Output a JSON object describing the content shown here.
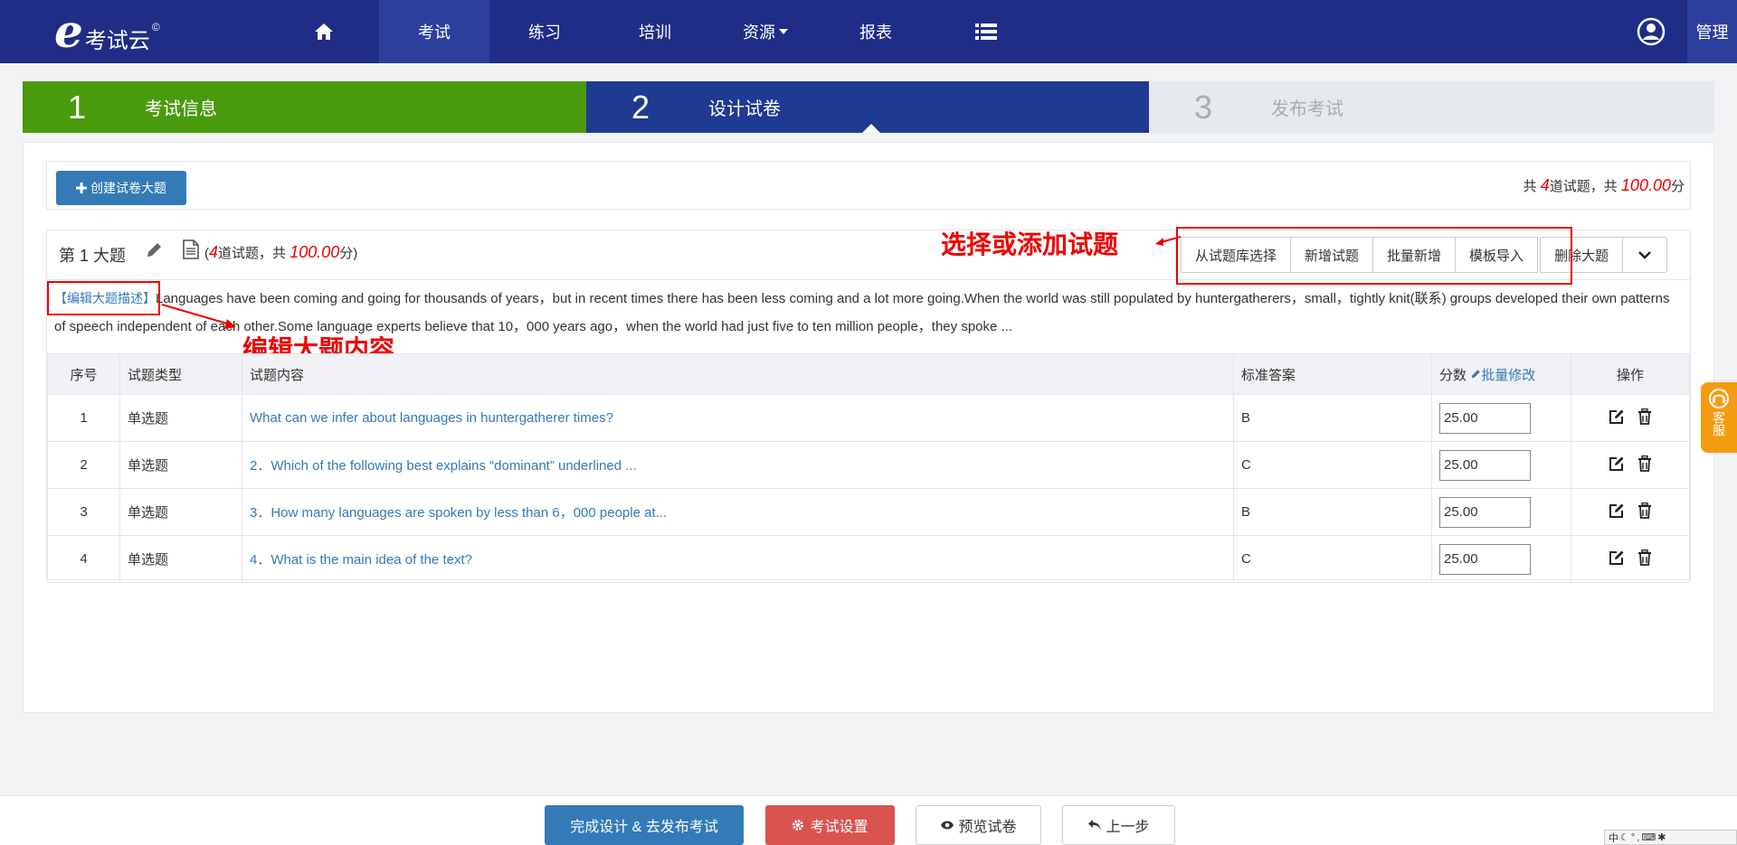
{
  "brand": {
    "name": "考试云",
    "mark": "e",
    "copyright": "©"
  },
  "nav": {
    "items": [
      "考试",
      "练习",
      "培训",
      "资源",
      "报表"
    ],
    "manage": "管理",
    "icons": {
      "home": "home-icon",
      "list": "list-icon",
      "user": "user-icon"
    }
  },
  "steps": [
    {
      "num": "1",
      "label": "考试信息"
    },
    {
      "num": "2",
      "label": "设计试卷"
    },
    {
      "num": "3",
      "label": "发布考试"
    }
  ],
  "toolbar": {
    "create_label": "创建试卷大题",
    "total_prefix": "共",
    "total_count": "4",
    "total_mid": "道试题，共",
    "total_score": "100.00",
    "total_suffix": "分"
  },
  "section": {
    "title": "第 1 大题",
    "count_open": "(",
    "count": "4",
    "count_mid": "道试题，共",
    "score": "100.00",
    "count_close": "分)",
    "buttons": [
      "从试题库选择",
      "新增试题",
      "批量新增",
      "模板导入",
      "删除大题"
    ],
    "annotation_buttons": "选择或添加试题",
    "annotation_desc": "编辑大题内容",
    "desc_link": "【编辑大题描述】",
    "desc_text": "Languages have been coming and going for thousands of years，but in recent times there has been less coming and a lot more going.When the world was still populated by huntergatherers，small，tightly knit(联系) groups developed their own patterns of speech independent of each other.Some language experts believe that 10，000 years ago，when the world had just five to ten million people，they spoke ..."
  },
  "table": {
    "headers": {
      "no": "序号",
      "type": "试题类型",
      "content": "试题内容",
      "answer": "标准答案",
      "score": "分数",
      "batch": "批量修改",
      "ops": "操作"
    },
    "rows": [
      {
        "no": "1",
        "type": "单选题",
        "content": "What can we infer about languages in huntergatherer times?",
        "answer": "B",
        "score": "25.00"
      },
      {
        "no": "2",
        "type": "单选题",
        "content": "2．Which of the following best explains “dominant” underlined ...",
        "answer": "C",
        "score": "25.00"
      },
      {
        "no": "3",
        "type": "单选题",
        "content": "3．How many languages are spoken by less than 6，000 people at...",
        "answer": "B",
        "score": "25.00"
      },
      {
        "no": "4",
        "type": "单选题",
        "content": "4．What is the main idea of the text?",
        "answer": "C",
        "score": "25.00"
      }
    ]
  },
  "side": {
    "label": "客服"
  },
  "bottom": {
    "finish": "完成设计 & 去发布考试",
    "settings": "考试设置",
    "preview": "预览试卷",
    "back": "上一步"
  },
  "ime": "中"
}
